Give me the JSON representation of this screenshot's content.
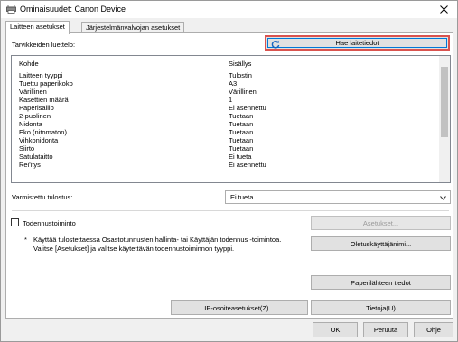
{
  "window": {
    "title": "Ominaisuudet: Canon Device",
    "icons": {
      "app": "printer-icon",
      "close": "close-icon"
    }
  },
  "tabs": [
    {
      "label": "Laitteen asetukset",
      "active": true
    },
    {
      "label": "Järjestelmänvalvojan asetukset",
      "active": false
    }
  ],
  "supplies": {
    "label": "Tarvikkeiden luettelo:",
    "fetch_button": "Hae laitetiedot",
    "fetch_icon": "refresh-icon"
  },
  "list": {
    "columns": [
      "Kohde",
      "Sisällys"
    ],
    "rows": [
      {
        "item": "Laitteen tyyppi",
        "value": "Tulostin"
      },
      {
        "item": "Tuettu paperikoko",
        "value": "A3"
      },
      {
        "item": "Värillinen",
        "value": "Värillinen"
      },
      {
        "item": "Kasettien määrä",
        "value": "1"
      },
      {
        "item": "Paperisäiliö",
        "value": "Ei asennettu"
      },
      {
        "item": "2-puolinen",
        "value": "Tuetaan"
      },
      {
        "item": "Nidonta",
        "value": "Tuetaan"
      },
      {
        "item": "Eko (nitomaton)",
        "value": "Tuetaan"
      },
      {
        "item": "Vihkonidonta",
        "value": "Tuetaan"
      },
      {
        "item": "Siirto",
        "value": "Tuetaan"
      },
      {
        "item": "Satulataitto",
        "value": "Ei tueta"
      },
      {
        "item": "Rei'itys",
        "value": "Ei asennettu"
      }
    ]
  },
  "verified_print": {
    "label": "Varmistettu tulostus:",
    "value": "Ei tueta"
  },
  "auth": {
    "checkbox_label": "Todennustoiminto",
    "checked": false,
    "settings_button": "Asetukset...",
    "note_bullet": "*",
    "note_line1": "Käyttää tulostettaessa Osastotunnusten hallinta- tai Käyttäjän todennus -toimintoa.",
    "note_line2": "Valitse [Asetukset] ja valitse käytettävän todennustoiminnon tyyppi.",
    "default_user_button": "Oletuskäyttäjänimi..."
  },
  "buttons": {
    "paper_source": "Paperilähteen tiedot",
    "ip_settings": "IP-osoiteasetukset(Z)...",
    "about": "Tietoja(U)"
  },
  "footer": {
    "ok": "OK",
    "cancel": "Peruuta",
    "help": "Ohje"
  }
}
